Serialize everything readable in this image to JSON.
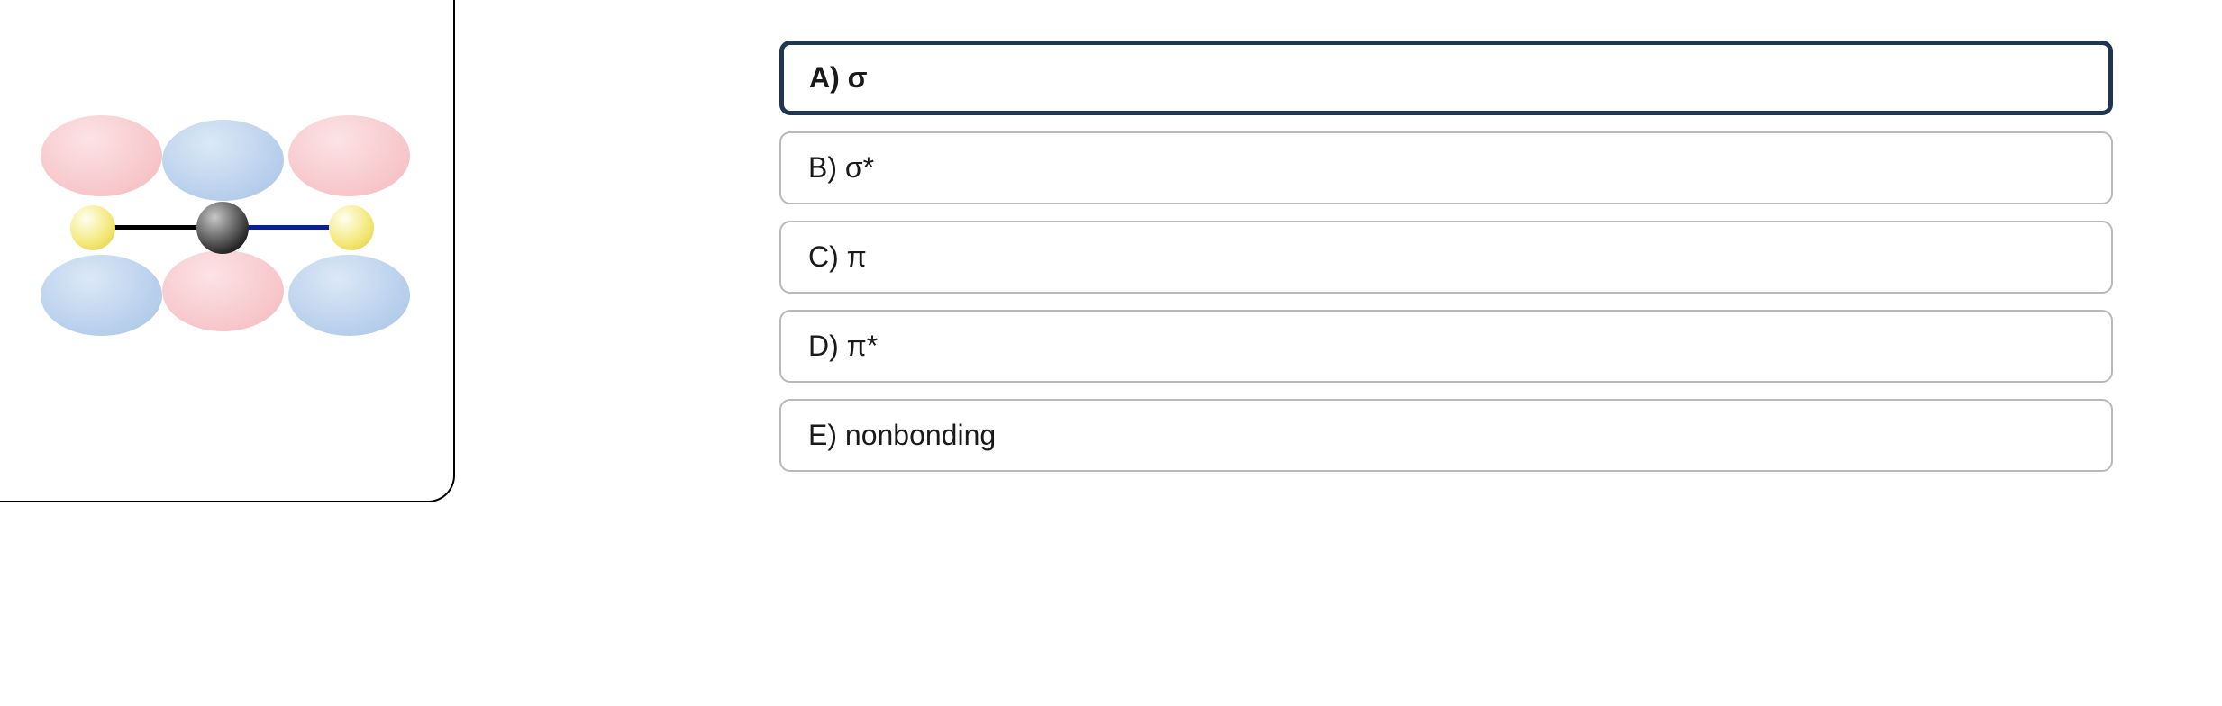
{
  "diagram": {
    "description": "molecular orbital diagram with three atoms (two yellow outer, one dark center) connected by bonds, with alternating pink/blue p-orbital lobes above and below"
  },
  "choices": [
    {
      "id": "A",
      "label": "A) σ",
      "selected": true
    },
    {
      "id": "B",
      "label": "B) σ*",
      "selected": false
    },
    {
      "id": "C",
      "label": "C) π",
      "selected": false
    },
    {
      "id": "D",
      "label": "D) π*",
      "selected": false
    },
    {
      "id": "E",
      "label": "E) nonbonding",
      "selected": false
    }
  ]
}
